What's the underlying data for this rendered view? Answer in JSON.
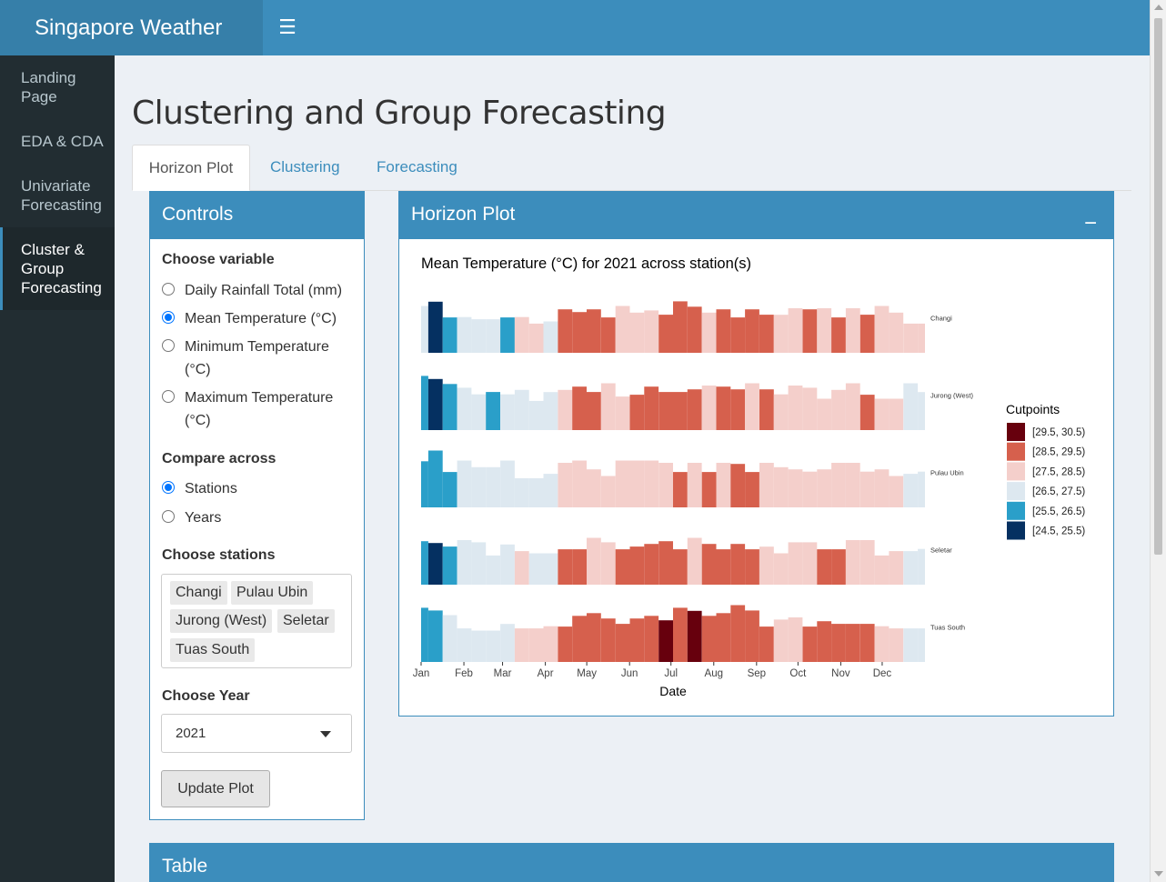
{
  "header": {
    "app_title": "Singapore Weather",
    "menu_icon": "bars-icon"
  },
  "sidebar": {
    "items": [
      {
        "label": "Landing Page"
      },
      {
        "label": "EDA & CDA"
      },
      {
        "label": "Univariate Forecasting"
      },
      {
        "label": "Cluster & Group Forecasting"
      }
    ]
  },
  "page": {
    "title": "Clustering and Group Forecasting"
  },
  "tabs": [
    {
      "label": "Horizon Plot"
    },
    {
      "label": "Clustering"
    },
    {
      "label": "Forecasting"
    }
  ],
  "controls": {
    "title": "Controls",
    "variable_label": "Choose variable",
    "variables": [
      {
        "label": "Daily Rainfall Total (mm)",
        "checked": false
      },
      {
        "label": "Mean Temperature (°C)",
        "checked": true
      },
      {
        "label": "Minimum Temperature (°C)",
        "checked": false
      },
      {
        "label": "Maximum Temperature (°C)",
        "checked": false
      }
    ],
    "compare_label": "Compare across",
    "compare_options": [
      {
        "label": "Stations",
        "checked": true
      },
      {
        "label": "Years",
        "checked": false
      }
    ],
    "stations_label": "Choose stations",
    "stations": [
      "Changi",
      "Pulau Ubin",
      "Jurong (West)",
      "Seletar",
      "Tuas South"
    ],
    "year_label": "Choose Year",
    "year_value": "2021",
    "update_label": "Update Plot"
  },
  "plot_box": {
    "title": "Horizon Plot",
    "collapse": "−"
  },
  "table_box": {
    "title": "Table"
  },
  "colors": {
    "accent": "#3c8dbc",
    "bands": [
      "#67000d",
      "#d6604d",
      "#f4cfcb",
      "#dde8f0",
      "#2a9fc9",
      "#053061"
    ]
  },
  "chart_data": {
    "type": "area",
    "title": "Mean Temperature (°C) for 2021 across station(s)",
    "xlabel": "Date",
    "ylabel": "",
    "x_ticks": [
      "Jan",
      "Feb",
      "Mar",
      "Apr",
      "May",
      "Jun",
      "Jul",
      "Aug",
      "Sep",
      "Oct",
      "Nov",
      "Dec"
    ],
    "origin": 27.5,
    "band_width": 1,
    "legend": {
      "title": "Cutpoints",
      "position": "right",
      "entries": [
        "[29.5, 30.5)",
        "[28.5, 29.5)",
        "[27.5, 28.5)",
        "[26.5, 27.5)",
        "[25.5, 26.5)",
        "[24.5, 25.5)"
      ]
    },
    "series": [
      {
        "name": "Changi",
        "values": [
          26.6,
          25.1,
          26.4,
          27.1,
          27.2,
          27.2,
          26.4,
          27.5,
          27.6,
          27.3,
          28.5,
          28.8,
          28.9,
          28.6,
          28.4,
          28.1,
          28.2,
          28.7,
          29.2,
          29.0,
          28.1,
          28.9,
          28.6,
          28.9,
          28.7,
          28.0,
          28.3,
          28.5,
          28.3,
          28.6,
          28.3,
          28.7,
          28.4,
          28.1,
          27.6,
          27.6
        ]
      },
      {
        "name": "Jurong (West)",
        "values": [
          25.7,
          25.1,
          26.0,
          26.8,
          26.5,
          26.3,
          26.5,
          26.9,
          27.4,
          27.0,
          28.1,
          28.5,
          28.7,
          28.4,
          27.8,
          28.6,
          28.5,
          28.7,
          28.7,
          28.8,
          28.3,
          28.9,
          28.8,
          28.4,
          28.8,
          27.5,
          28.3,
          28.2,
          27.7,
          28.1,
          28.4,
          28.6,
          27.7,
          27.7,
          26.6,
          27.0
        ]
      },
      {
        "name": "Pulau Ubin",
        "values": [
          26.0,
          25.6,
          26.4,
          26.6,
          26.9,
          26.9,
          26.6,
          27.4,
          27.4,
          27.2,
          28.3,
          28.4,
          28.0,
          27.7,
          28.4,
          28.4,
          28.4,
          28.3,
          28.6,
          28.3,
          28.6,
          28.3,
          28.5,
          28.6,
          28.3,
          28.1,
          28.0,
          27.9,
          28.0,
          28.3,
          28.3,
          27.9,
          28.0,
          27.7,
          27.2,
          27.1
        ]
      },
      {
        "name": "Seletar",
        "values": [
          26.1,
          25.4,
          26.3,
          26.7,
          26.8,
          27.4,
          26.9,
          27.8,
          27.3,
          27.3,
          28.6,
          28.6,
          28.4,
          28.2,
          28.6,
          28.7,
          28.8,
          28.5,
          28.6,
          28.4,
          28.8,
          28.6,
          28.8,
          28.6,
          28.0,
          27.7,
          28.2,
          28.2,
          28.6,
          28.6,
          28.3,
          28.3,
          27.6,
          27.8,
          27.2,
          27.1
        ]
      },
      {
        "name": "Tuas South",
        "values": [
          25.7,
          25.8,
          26.6,
          27.2,
          27.3,
          27.3,
          27.0,
          27.8,
          27.8,
          27.9,
          28.6,
          29.0,
          29.1,
          28.9,
          28.7,
          28.9,
          29.0,
          29.6,
          29.3,
          29.5,
          29.0,
          29.1,
          29.4,
          29.2,
          28.6,
          28.2,
          28.3,
          28.6,
          28.8,
          28.7,
          28.7,
          28.7,
          27.9,
          27.8,
          27.2,
          27.2
        ]
      }
    ]
  }
}
